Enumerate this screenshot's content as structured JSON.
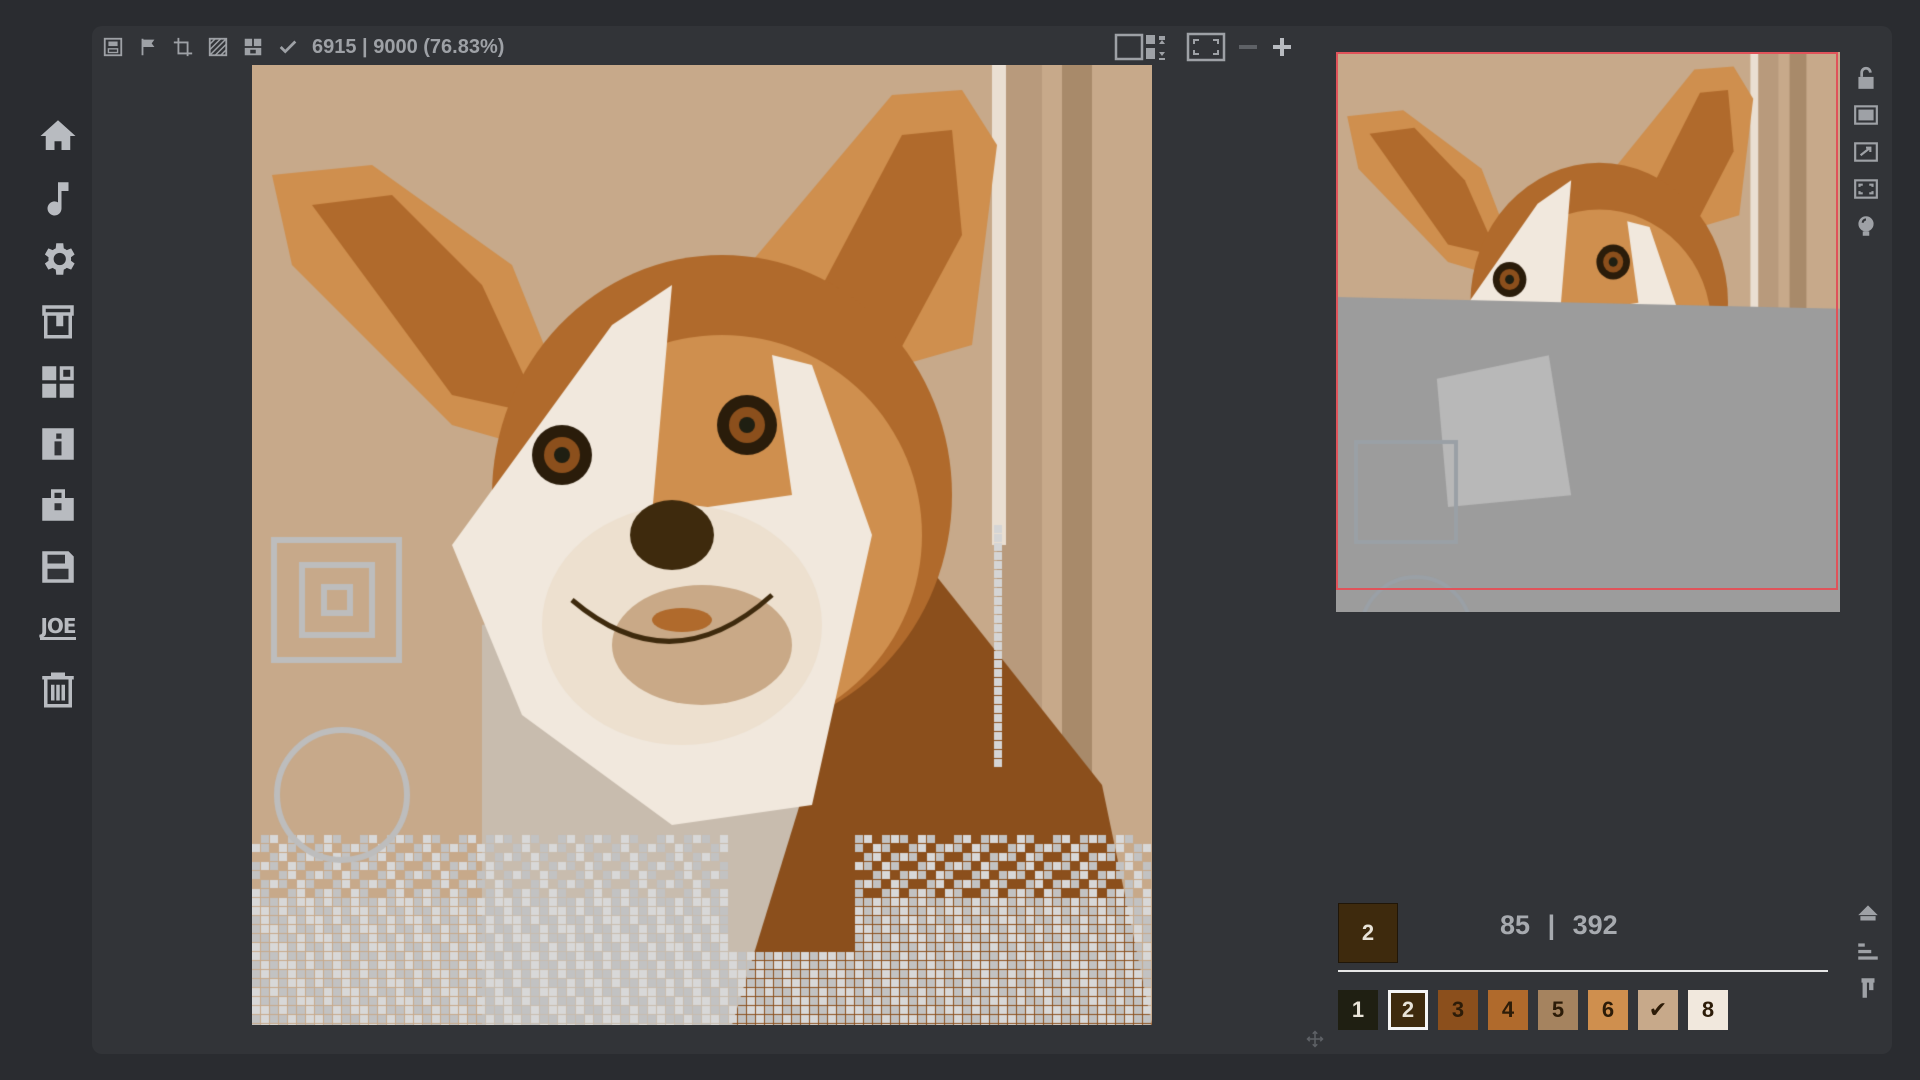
{
  "toolbar": {
    "icons": [
      "save-icon",
      "flag-icon",
      "crop-icon",
      "hatch-icon",
      "lock-pattern-icon",
      "check-icon"
    ],
    "progress": "6915 | 9000 (76.83%)",
    "progress_fraction": 0.7683,
    "right_icons": [
      "layout-icon",
      "fullscreen-icon",
      "zoom-out-icon",
      "zoom-in-icon"
    ]
  },
  "sidebar": {
    "items": [
      {
        "name": "home-icon"
      },
      {
        "name": "music-icon"
      },
      {
        "name": "gear-icon"
      },
      {
        "name": "paint-bucket-icon"
      },
      {
        "name": "dashboard-icon"
      },
      {
        "name": "info-icon"
      },
      {
        "name": "toolbox-icon"
      },
      {
        "name": "save-icon"
      },
      {
        "name": "joe-logo",
        "label": "JOE"
      },
      {
        "name": "trash-icon"
      }
    ]
  },
  "preview_tools": [
    "unlock-icon",
    "frame-icon",
    "expand-icon",
    "fit-icon",
    "hint-icon"
  ],
  "selected_color": {
    "number": "2",
    "hex": "#3e2a0d"
  },
  "color_stats": {
    "done": "85",
    "separator": "|",
    "total": "392"
  },
  "palette": [
    {
      "label": "1",
      "bg": "#1f1f12",
      "fg": "#e8e3d8"
    },
    {
      "label": "2",
      "bg": "#3e2a0d",
      "fg": "#e8e3d8",
      "selected": true
    },
    {
      "label": "3",
      "bg": "#8b4f1c",
      "fg": "#2d1c08"
    },
    {
      "label": "4",
      "bg": "#b06a2c",
      "fg": "#2d1c08"
    },
    {
      "label": "5",
      "bg": "#a5835f",
      "fg": "#2d1c08"
    },
    {
      "label": "6",
      "bg": "#cf8f4e",
      "fg": "#2d1c08"
    },
    {
      "label": "✔",
      "bg": "#c7a98a",
      "fg": "#2d1c08"
    },
    {
      "label": "8",
      "bg": "#f1e8dd",
      "fg": "#2d1c08"
    }
  ],
  "bottom_tools": [
    "home-tool-icon",
    "sort-icon",
    "brush-icon"
  ],
  "colors": {
    "background": "#2a2c30",
    "panel": "#323438",
    "canvas": "#c7a98a",
    "highlight": "#e0535a"
  }
}
